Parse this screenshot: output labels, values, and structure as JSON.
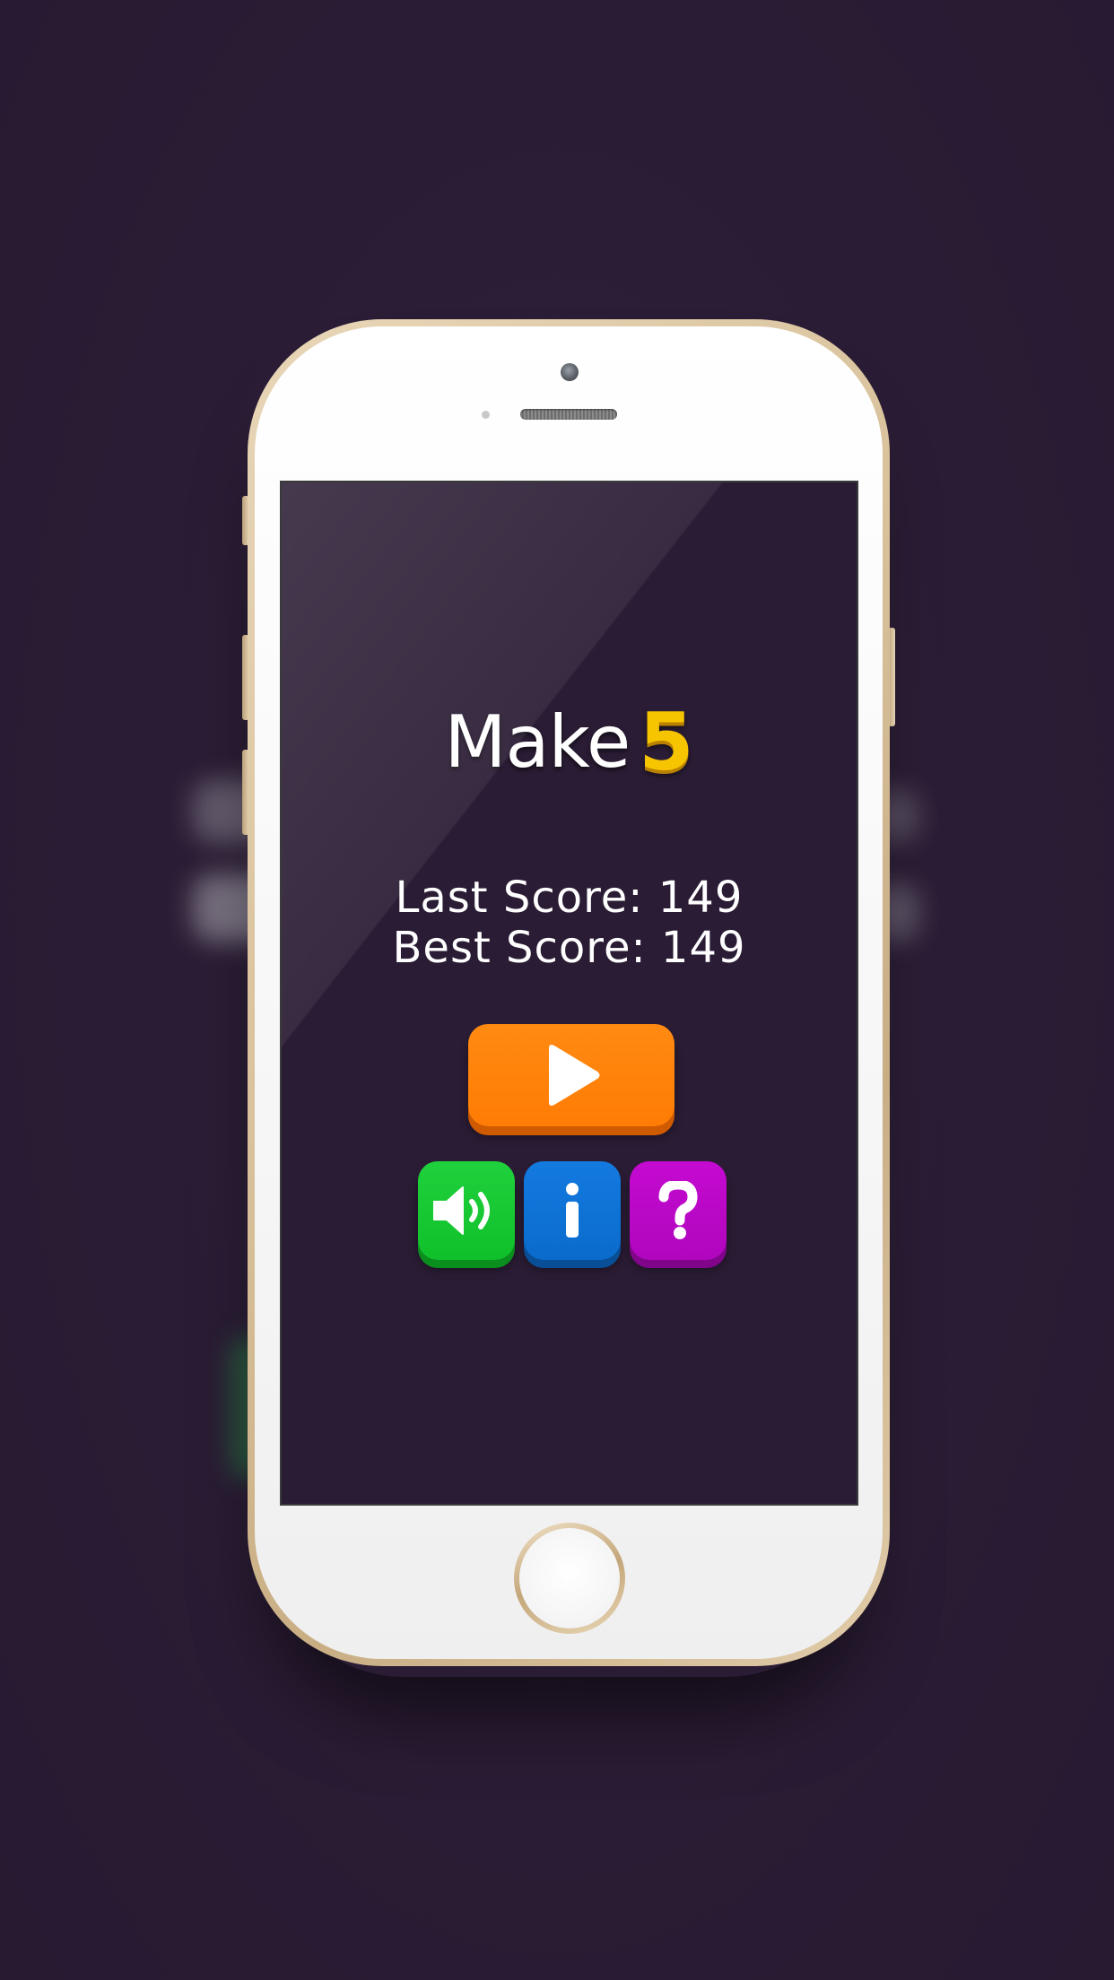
{
  "app": {
    "title_word": "Make",
    "title_number": "5"
  },
  "scores": {
    "last": "Last Score: 149",
    "best": "Best Score: 149"
  },
  "buttons": {
    "play_icon": "play-icon",
    "sound_icon": "speaker-icon",
    "info_icon": "info-icon",
    "help_icon": "question-icon"
  },
  "colors": {
    "background": "#2a1c34",
    "play": "#ff7f08",
    "sound": "#15c831",
    "info": "#0e72d6",
    "help": "#bb08c7",
    "accent_five": "#f7c400"
  }
}
